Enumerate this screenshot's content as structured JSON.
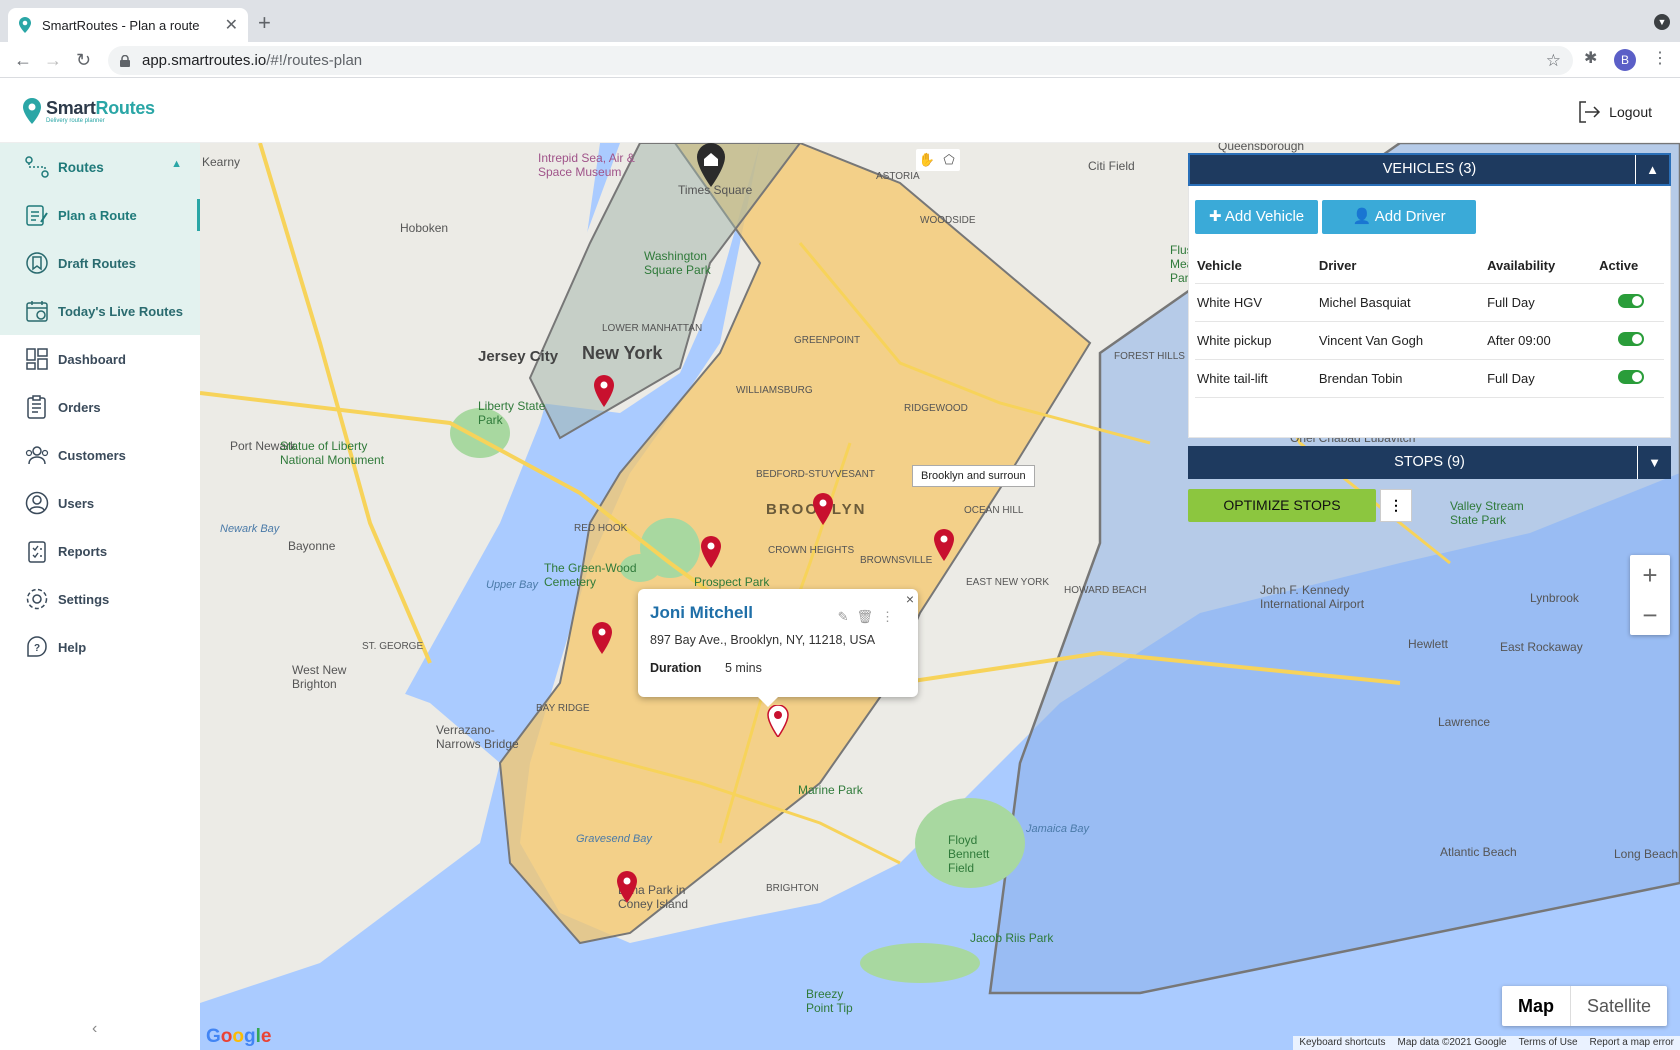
{
  "browser": {
    "tab_title": "SmartRoutes - Plan a route",
    "new_tab": "+",
    "url_host": "app.smartroutes.io",
    "url_path": "/#!/routes-plan",
    "avatar_letter": "B"
  },
  "app": {
    "logo_name_a": "Smart",
    "logo_name_b": "Routes",
    "logo_tagline": "Delivery route planner",
    "logout_label": "Logout"
  },
  "sidebar": {
    "group_label": "Routes",
    "items": [
      {
        "label": "Plan a Route",
        "icon": "plan-route-icon"
      },
      {
        "label": "Draft Routes",
        "icon": "draft-routes-icon"
      },
      {
        "label": "Today's Live Routes",
        "icon": "live-routes-icon"
      },
      {
        "label": "Dashboard",
        "icon": "dashboard-icon"
      },
      {
        "label": "Orders",
        "icon": "orders-icon"
      },
      {
        "label": "Customers",
        "icon": "customers-icon"
      },
      {
        "label": "Users",
        "icon": "users-icon"
      },
      {
        "label": "Reports",
        "icon": "reports-icon"
      },
      {
        "label": "Settings",
        "icon": "settings-icon"
      },
      {
        "label": "Help",
        "icon": "help-icon"
      }
    ]
  },
  "map": {
    "places": {
      "new_york": "New York",
      "brooklyn": "BROOKLYN",
      "jersey_city": "Jersey City",
      "hoboken": "Hoboken",
      "kearny": "Kearny",
      "bayonne": "Bayonne",
      "port_newark": "Port Newark",
      "times_square": "Times Square",
      "intrepid": "Intrepid Sea, Air & Space Museum",
      "washington_sq": "Washington Square Park",
      "liberty": "Liberty State Park",
      "statue": "Statue of Liberty National Monument",
      "prospect": "Prospect Park",
      "greenwood": "The Green-Wood Cemetery",
      "marine_park": "Marine Park",
      "floyd": "Floyd Bennett Field",
      "jacob_riis": "Jacob Riis Park",
      "breezy": "Breezy Point Tip",
      "coney": "Luna Park in Coney Island",
      "citi": "Citi Field",
      "flushing": "Flushing Meadows Corona Park",
      "jfk": "John F. Kennedy International Airport",
      "valley": "Valley Stream State Park",
      "atlantic": "Atlantic Beach",
      "long_beach": "Long Beach",
      "howard_beach": "HOWARD BEACH",
      "east_rockaway": "East Rockaway",
      "lynbrook": "Lynbrook",
      "hewlett": "Hewlett",
      "lawrence": "Lawrence",
      "woodside": "WOODSIDE",
      "astoria": "ASTORIA",
      "ridgewood": "RIDGEWOOD",
      "williamsburg": "WILLIAMSBURG",
      "bed_stuy": "BEDFORD-STUYVESANT",
      "crown": "CROWN HEIGHTS",
      "brownsville": "BROWNSVILLE",
      "red_hook": "RED HOOK",
      "bay_ridge": "BAY RIDGE",
      "staten": "ST. GEORGE",
      "west_brighton": "West New Brighton",
      "verrazano": "Verrazano-Narrows Bridge",
      "brighton": "BRIGHTON",
      "east_ny": "EAST NEW YORK",
      "forest_hills": "FOREST HILLS",
      "ocean_hill": "OCEAN HILL",
      "greenpoint": "GREENPOINT",
      "lower_manhattan": "LOWER MANHATTAN",
      "queensborough": "Queensborough",
      "hudson": "Upper Bay",
      "newark_bay": "Newark Bay",
      "jamaica_bay": "Jamaica Bay",
      "gravesend_bay": "Gravesend Bay",
      "chabad": "Ohel Chabad Lubavitch"
    },
    "zone_tooltip": "Brooklyn and surroun",
    "zoom_in": "+",
    "zoom_out": "−",
    "map_type_map": "Map",
    "map_type_sat": "Satellite",
    "attribution": [
      "Keyboard shortcuts",
      "Map data ©2021 Google",
      "Terms of Use",
      "Report a map error"
    ]
  },
  "infowindow": {
    "name": "Joni Mitchell",
    "address": "897 Bay Ave., Brooklyn, NY, 11218, USA",
    "duration_label": "Duration",
    "duration_value": "5 mins",
    "close": "×"
  },
  "vehicles_panel": {
    "title": "VEHICLES (3)",
    "add_vehicle": "Add Vehicle",
    "add_driver": "Add Driver",
    "columns": [
      "Vehicle",
      "Driver",
      "Availability",
      "Active"
    ],
    "rows": [
      {
        "vehicle": "White HGV",
        "driver": "Michel Basquiat",
        "availability": "Full Day",
        "active": true
      },
      {
        "vehicle": "White pickup",
        "driver": "Vincent Van Gogh",
        "availability": "After 09:00",
        "active": true
      },
      {
        "vehicle": "White tail-lift",
        "driver": "Brendan Tobin",
        "availability": "Full Day",
        "active": true
      }
    ]
  },
  "stops_panel": {
    "title": "STOPS (9)",
    "optimize": "OPTIMIZE STOPS",
    "more": "⋮"
  },
  "colors": {
    "brand_teal": "#2aa6a6",
    "navy": "#1e3a5f",
    "button_blue": "#3aaad8",
    "button_green": "#8cc63f",
    "zone_orange": "#f5c76a",
    "zone_blue": "#8ab0ea",
    "marker_red": "#c8102e"
  }
}
